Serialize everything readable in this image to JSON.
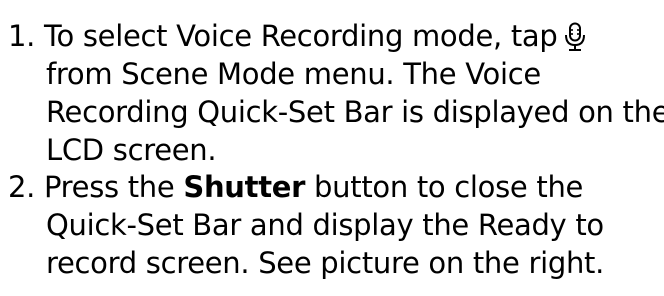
{
  "steps": [
    {
      "number": "1.",
      "line1": "To select Voice Recording mode, tap",
      "icon": "microphone-icon",
      "line2": "from Scene Mode menu. The Voice",
      "line3": "Recording Quick-Set Bar is displayed on the",
      "line4": "LCD screen."
    },
    {
      "number": "2.",
      "line1_pre": "Press the ",
      "line1_bold": "Shutter",
      "line1_post": " button to close the",
      "line2": "Quick-Set Bar and display the Ready to",
      "line3": "record screen. See picture on the right."
    }
  ]
}
